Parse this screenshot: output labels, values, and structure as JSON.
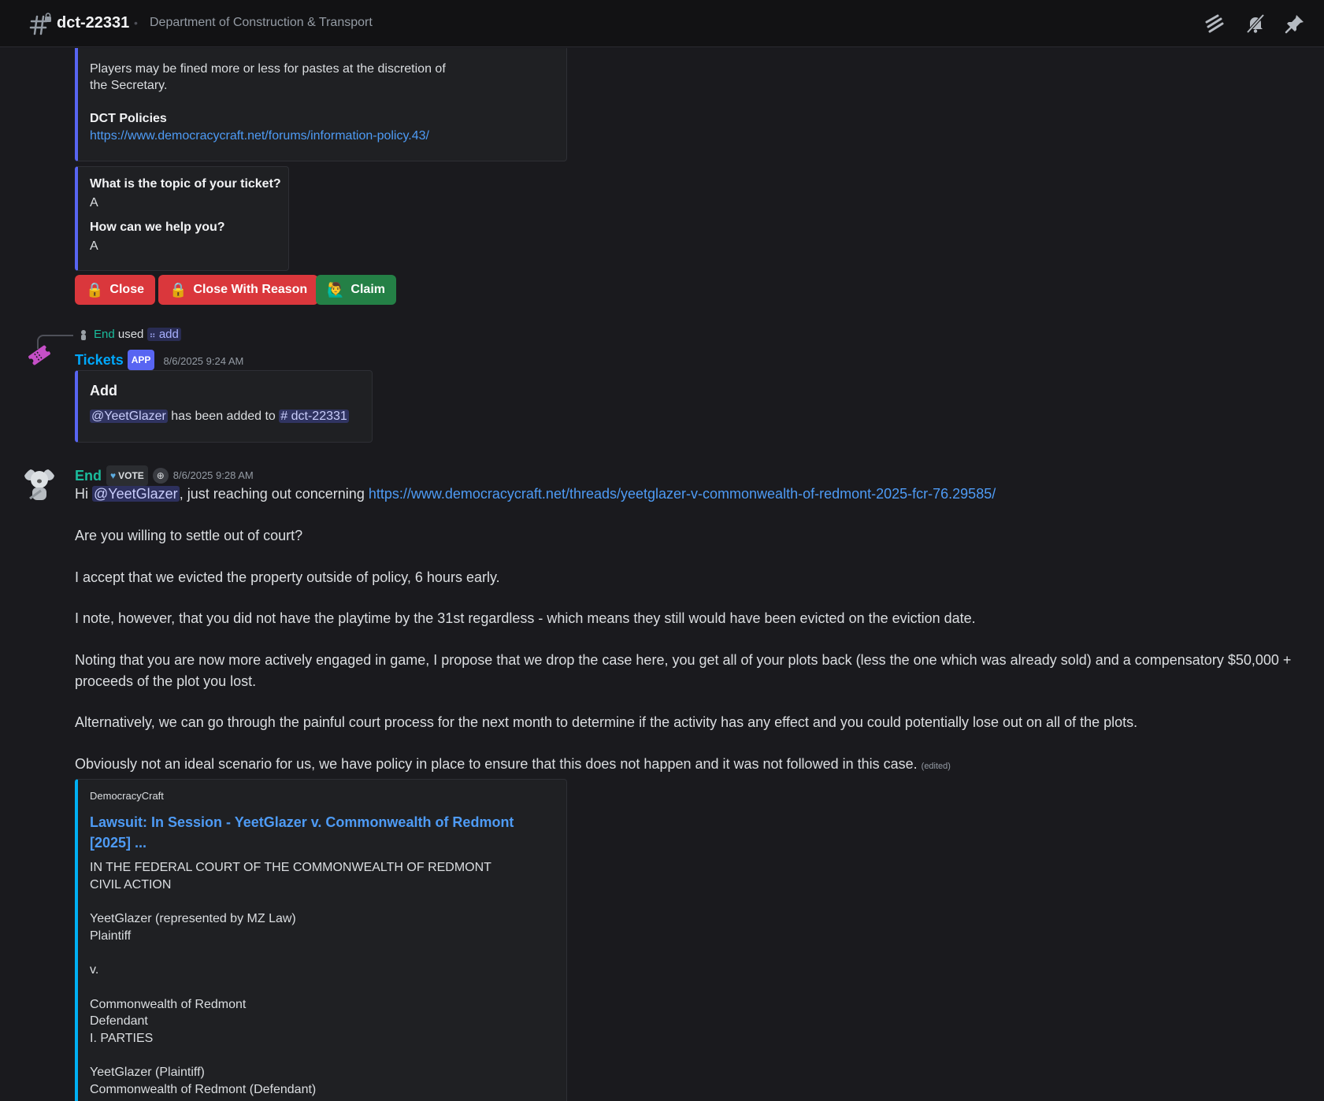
{
  "header": {
    "channel_name": "dct-22331",
    "topic": "Department of Construction & Transport",
    "icons": [
      "threads-icon",
      "mute-bell-icon",
      "pin-icon"
    ]
  },
  "top_embed": {
    "text_line1": "Players may be fined more or less for pastes at the discretion of",
    "text_line2": "the Secretary.",
    "policies_title": "DCT Policies",
    "policies_link": "https://www.democracycraft.net/forums/information-policy.43/"
  },
  "qa_embed": {
    "q1": "What is the topic of your ticket?",
    "a1": "A",
    "q2": "How can we help you?",
    "a2": "A"
  },
  "buttons": {
    "close": "Close",
    "close_reason": "Close With Reason",
    "claim": "Claim"
  },
  "reply": {
    "user": "End",
    "used": "used",
    "command": "add"
  },
  "tickets_msg": {
    "author": "Tickets",
    "badge": "APP",
    "timestamp": "8/6/2025 9:24 AM",
    "embed_title": "Add",
    "mention": "@YeetGlazer",
    "middle_text": "has been added to",
    "channel_mention": "# dct-22331"
  },
  "end_msg": {
    "author": "End",
    "badge": "VOTE",
    "timestamp": "8/6/2025 9:28 AM",
    "line1_prefix": "Hi",
    "line1_mention": "@YeetGlazer",
    "line1_mid": ", just reaching out concerning",
    "line1_link": "https://www.democracycraft.net/threads/yeetglazer-v-commonwealth-of-redmont-2025-fcr-76.29585/",
    "p2": "Are you willing to settle out of court?",
    "p3": "I accept that we evicted the property outside of policy, 6 hours early.",
    "p4": "I note, however, that you did not have the playtime by the 31st regardless - which means they still would have been evicted on the eviction date.",
    "p5a": "Noting that you are now more actively engaged in game, I propose that we drop the case here, you get all of your plots back (less the one which was already sold) and a compensatory $50,000 +",
    "p5b": "proceeds of the plot you lost.",
    "p6": "Alternatively, we can go through the painful court process for the next month to determine if the activity has any effect and you could potentially lose out on all of the plots.",
    "p7": "Obviously not an ideal scenario for us, we have policy in place to ensure that this does not happen and it was not followed in this case.",
    "edited": "(edited)"
  },
  "link_embed": {
    "provider": "DemocracyCraft",
    "title_line1": "Lawsuit: In Session - YeetGlazer v. Commonwealth of Redmont",
    "title_line2": "[2025] ...",
    "lines": [
      "IN THE FEDERAL COURT OF THE COMMONWEALTH OF REDMONT",
      "CIVIL ACTION",
      "",
      "YeetGlazer (represented by MZ Law)",
      "Plaintiff",
      "",
      "v.",
      "",
      "Commonwealth of Redmont",
      "Defendant",
      "I. PARTIES",
      "",
      "YeetGlazer (Plaintiff)",
      "Commonwealth of Redmont (Defendant)"
    ]
  },
  "colors": {
    "background": "#1a1a1e",
    "accent": "#5865f2",
    "link": "#4e9bf5",
    "danger": "#da373c",
    "success": "#248046",
    "end_name": "#1abc9c",
    "tickets_name": "#00a8fc"
  }
}
